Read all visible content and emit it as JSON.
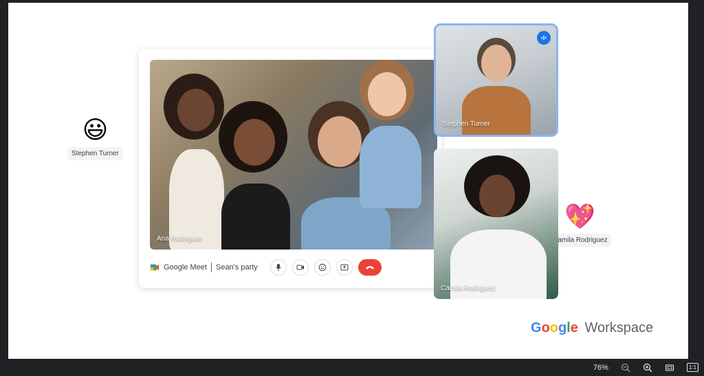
{
  "reactions": {
    "left": {
      "emoji": "😃",
      "name": "Stephen Turner"
    },
    "right": {
      "emoji": "💖",
      "name": "Camila Rodriguez"
    }
  },
  "main_video": {
    "participant": "Ana Rodriguez"
  },
  "toolbar": {
    "brand": "Google Meet",
    "meeting_name": "Sean's party",
    "controls": [
      "mic-button",
      "camera-button",
      "reactions-button",
      "present-button",
      "end-call-button"
    ]
  },
  "tiles": {
    "stephen": {
      "name": "Stephen Turner",
      "speaking": true
    },
    "camila": {
      "name": "Camila Rodriguez"
    }
  },
  "workspace_logo": {
    "google": [
      "G",
      "o",
      "o",
      "g",
      "l",
      "e"
    ],
    "suffix": "Workspace"
  },
  "colors": {
    "blue": "#4285f4",
    "red": "#ea4335",
    "yellow": "#fbbc05",
    "green": "#34a853",
    "accent_border": "#8ab4f8",
    "end_call": "#ea4335"
  },
  "statusbar": {
    "zoom": "76%",
    "actual_size": "1:1"
  }
}
